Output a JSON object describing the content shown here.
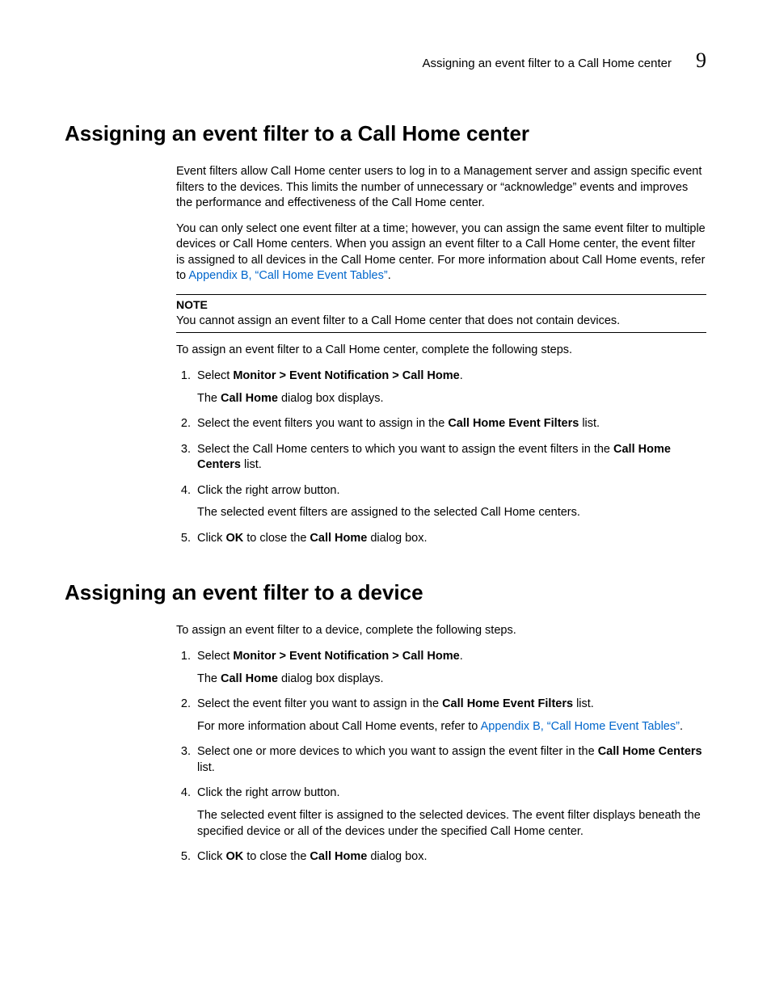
{
  "header": {
    "running_title": "Assigning an event filter to a Call Home center",
    "chapter": "9"
  },
  "section1": {
    "heading": "Assigning an event filter to a Call Home center",
    "para1": "Event filters allow Call Home center users to log in to a Management server and assign specific event filters to the devices. This limits the number of unnecessary or “acknowledge” events and improves the performance and effectiveness of the Call Home center.",
    "para2a": "You can only select one event filter at a time; however, you can assign the same event filter to multiple devices or Call Home centers. When you assign an event filter to a Call Home center, the event filter is assigned to all devices in the Call Home center. For more information about Call Home events, refer to ",
    "para2_link": "Appendix B, “Call Home Event Tables”",
    "para2b": ".",
    "note_label": "NOTE",
    "note_text": "You cannot assign an event filter to a Call Home center that does not contain devices.",
    "para3": "To assign an event filter to a Call Home center, complete the following steps.",
    "step1_a": "Select ",
    "step1_bold": "Monitor > Event Notification > Call Home",
    "step1_b": ".",
    "step1_sub_a": "The ",
    "step1_sub_bold": "Call Home",
    "step1_sub_b": " dialog box displays.",
    "step2_a": "Select the event filters you want to assign in the ",
    "step2_bold": "Call Home Event Filters",
    "step2_b": " list.",
    "step3_a": "Select the Call Home centers to which you want to assign the event filters in the ",
    "step3_bold": "Call Home Centers",
    "step3_b": " list.",
    "step4": "Click the right arrow button.",
    "step4_sub": "The selected event filters are assigned to the selected Call Home centers.",
    "step5_a": "Click ",
    "step5_bold1": "OK",
    "step5_b": " to close the ",
    "step5_bold2": "Call Home",
    "step5_c": " dialog box."
  },
  "section2": {
    "heading": "Assigning an event filter to a device",
    "para1": "To assign an event filter to a device, complete the following steps.",
    "step1_a": "Select ",
    "step1_bold": "Monitor > Event Notification > Call Home",
    "step1_b": ".",
    "step1_sub_a": "The ",
    "step1_sub_bold": "Call Home",
    "step1_sub_b": " dialog box displays.",
    "step2_a": "Select the event filter you want to assign in the ",
    "step2_bold": "Call Home Event Filters",
    "step2_b": " list.",
    "step2_sub_a": "For more information about Call Home events, refer to ",
    "step2_sub_link": "Appendix B, “Call Home Event Tables”",
    "step2_sub_b": ".",
    "step3_a": "Select one or more devices to which you want to assign the event filter in the ",
    "step3_bold": "Call Home Centers",
    "step3_b": " list.",
    "step4": "Click the right arrow button.",
    "step4_sub": "The selected event filter is assigned to the selected devices. The event filter displays beneath the specified device or all of the devices under the specified Call Home center.",
    "step5_a": "Click ",
    "step5_bold1": "OK",
    "step5_b": " to close the ",
    "step5_bold2": "Call Home",
    "step5_c": " dialog box."
  }
}
